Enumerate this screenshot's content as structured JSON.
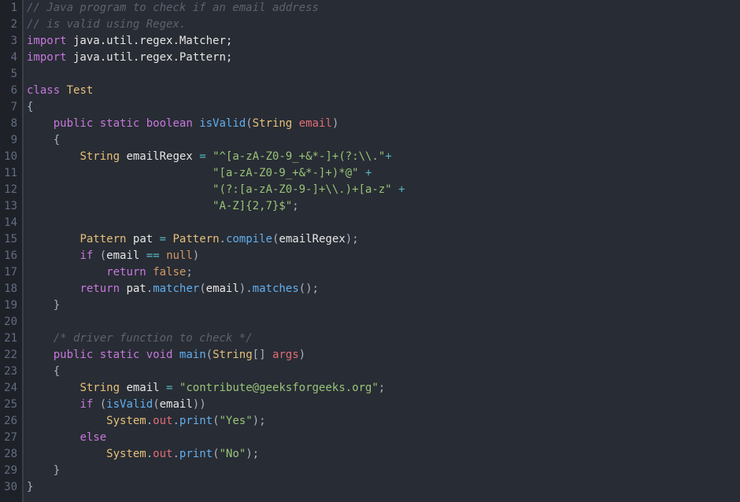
{
  "gutter": [
    "1",
    "2",
    "3",
    "4",
    "5",
    "6",
    "7",
    "8",
    "9",
    "10",
    "11",
    "12",
    "13",
    "14",
    "15",
    "16",
    "17",
    "18",
    "19",
    "20",
    "21",
    "22",
    "23",
    "24",
    "25",
    "26",
    "27",
    "28",
    "29",
    "30"
  ],
  "l1": {
    "c1": "// Java program to check if an email address"
  },
  "l2": {
    "c1": "// is valid using Regex."
  },
  "l3": {
    "kw": "import",
    "pkg": " java.util.regex.Matcher;"
  },
  "l4": {
    "kw": "import",
    "pkg": " java.util.regex.Pattern;"
  },
  "l6": {
    "kw": "class",
    "name": "Test"
  },
  "l7": {
    "brace": "{"
  },
  "l8": {
    "indent": "    ",
    "kw1": "public",
    "kw2": "static",
    "type": "boolean",
    "fn": "isValid",
    "lp": "(",
    "ptype": "String",
    "pname": "email",
    "rp": ")"
  },
  "l9": {
    "indent": "    ",
    "brace": "{"
  },
  "l10": {
    "indent": "        ",
    "type": "String",
    "var": "emailRegex",
    "op": "=",
    "str": "\"^[a-zA-Z0-9_+&*-]+(?:\\\\.\"",
    "plus": "+"
  },
  "l11": {
    "indent": "                            ",
    "str": "\"[a-zA-Z0-9_+&*-]+)*@\"",
    "plus": " +"
  },
  "l12": {
    "indent": "                            ",
    "str": "\"(?:[a-zA-Z0-9-]+\\\\.)+[a-z\"",
    "plus": " +"
  },
  "l13": {
    "indent": "                            ",
    "str": "\"A-Z]{2,7}$\"",
    "semi": ";"
  },
  "l15": {
    "indent": "        ",
    "type": "Pattern",
    "var": "pat",
    "op": "=",
    "cls": "Pattern",
    "dot": ".",
    "fn": "compile",
    "lp": "(",
    "arg": "emailRegex",
    "rp": ");"
  },
  "l16": {
    "indent": "        ",
    "kw": "if",
    "lp": "(",
    "arg": "email",
    "op": "==",
    "null": "null",
    "rp": ")"
  },
  "l17": {
    "indent": "            ",
    "kw": "return",
    "val": "false",
    "semi": ";"
  },
  "l18": {
    "indent": "        ",
    "kw": "return",
    "var": "pat",
    "dot1": ".",
    "fn1": "matcher",
    "lp1": "(",
    "arg": "email",
    "rp1": ").",
    "fn2": "matches",
    "lp2": "();"
  },
  "l19": {
    "indent": "    ",
    "brace": "}"
  },
  "l21": {
    "indent": "    ",
    "c1": "/* driver function to check */"
  },
  "l22": {
    "indent": "    ",
    "kw1": "public",
    "kw2": "static",
    "type": "void",
    "fn": "main",
    "lp": "(",
    "ptype": "String",
    "arr": "[]",
    "pname": "args",
    "rp": ")"
  },
  "l23": {
    "indent": "    ",
    "brace": "{"
  },
  "l24": {
    "indent": "        ",
    "type": "String",
    "var": "email",
    "op": "=",
    "str": "\"contribute@geeksforgeeks.org\"",
    "semi": ";"
  },
  "l25": {
    "indent": "        ",
    "kw": "if",
    "lp": "(",
    "fn": "isValid",
    "lp2": "(",
    "arg": "email",
    "rp": "))"
  },
  "l26": {
    "indent": "            ",
    "cls": "System",
    "dot1": ".",
    "out": "out",
    "dot2": ".",
    "fn": "print",
    "lp": "(",
    "str": "\"Yes\"",
    "rp": ");"
  },
  "l27": {
    "indent": "        ",
    "kw": "else"
  },
  "l28": {
    "indent": "            ",
    "cls": "System",
    "dot1": ".",
    "out": "out",
    "dot2": ".",
    "fn": "print",
    "lp": "(",
    "str": "\"No\"",
    "rp": ");"
  },
  "l29": {
    "indent": "    ",
    "brace": "}"
  },
  "l30": {
    "brace": "}"
  }
}
